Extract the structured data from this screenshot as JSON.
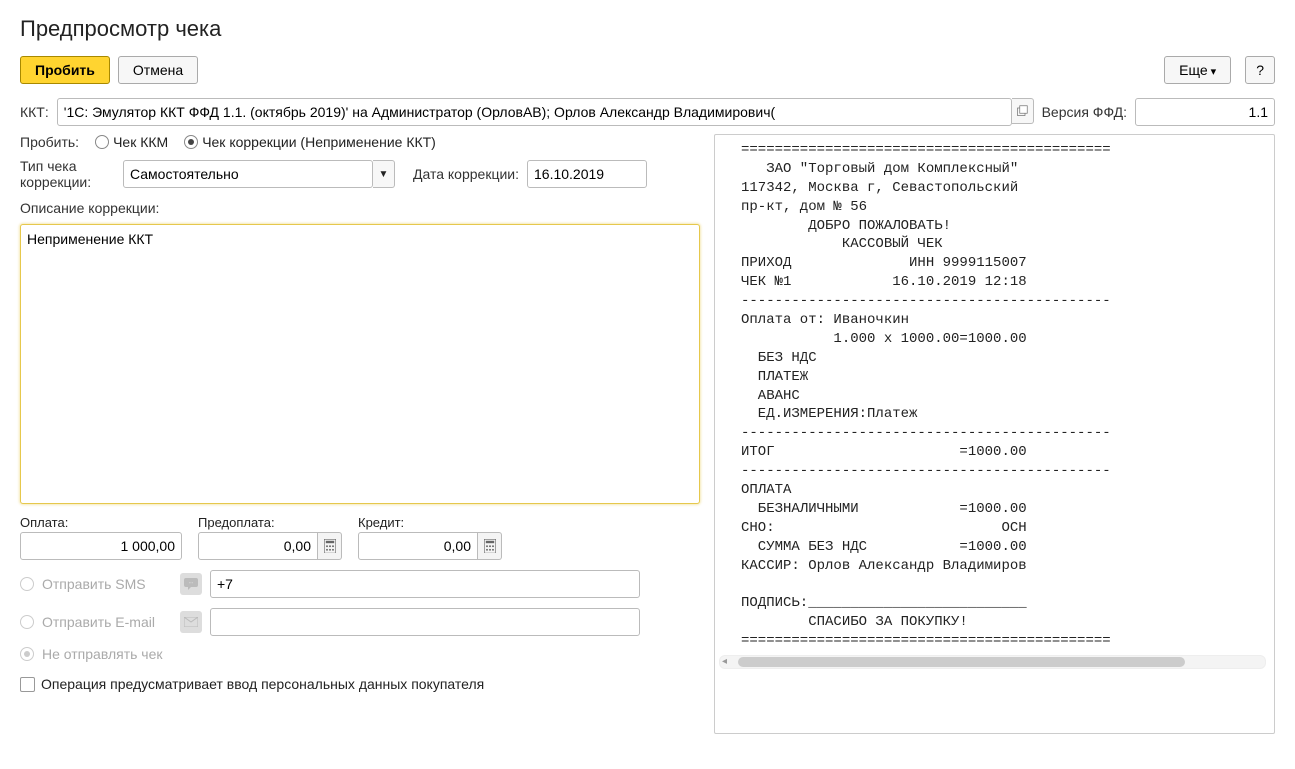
{
  "page_title": "Предпросмотр чека",
  "toolbar": {
    "probity": "Пробить",
    "cancel": "Отмена",
    "more": "Еще",
    "help": "?"
  },
  "kkt": {
    "label": "ККТ:",
    "value": "'1С: Эмулятор ККТ ФФД 1.1. (октябрь 2019)' на Администратор (ОрловАВ); Орлов Александр Владимирович("
  },
  "ffd": {
    "label": "Версия ФФД:",
    "value": "1.1"
  },
  "probity_mode": {
    "label": "Пробить:",
    "option1": "Чек ККМ",
    "option2": "Чек коррекции (Неприменение ККТ)"
  },
  "correction": {
    "type_label": "Тип чека коррекции:",
    "type_value": "Самостоятельно",
    "date_label": "Дата коррекции:",
    "date_value": "16.10.2019"
  },
  "description": {
    "label": "Описание коррекции:",
    "value": "Неприменение ККТ"
  },
  "payment": {
    "oplata_label": "Оплата:",
    "oplata_value": "1 000,00",
    "predoplata_label": "Предоплата:",
    "predoplata_value": "0,00",
    "credit_label": "Кредит:",
    "credit_value": "0,00"
  },
  "send": {
    "sms_label": "Отправить SMS",
    "sms_value": "+7",
    "email_label": "Отправить E-mail",
    "none_label": "Не отправлять чек"
  },
  "personal_data_label": "Операция предусматривает ввод персональных данных покупателя",
  "receipt_text": "============================================\n   ЗАО \"Торговый дом Комплексный\"\n117342, Москва г, Севастопольский\nпр-кт, дом № 56\n        ДОБРО ПОЖАЛОВАТЬ!\n            КАССОВЫЙ ЧЕК\nПРИХОД              ИНН 9999115007\nЧЕК №1            16.10.2019 12:18\n--------------------------------------------\nОплата от: Иваночкин\n           1.000 x 1000.00=1000.00\n  БЕЗ НДС\n  ПЛАТЕЖ\n  АВАНС\n  ЕД.ИЗМЕРЕНИЯ:Платеж\n--------------------------------------------\nИТОГ                      =1000.00\n--------------------------------------------\nОПЛАТА\n  БЕЗНАЛИЧНЫМИ            =1000.00\nСНО:                           ОСН\n  СУММА БЕЗ НДС           =1000.00\nКАССИР: Орлов Александр Владимиров\n\nПОДПИСЬ:__________________________\n        СПАСИБО ЗА ПОКУПКУ!\n============================================"
}
